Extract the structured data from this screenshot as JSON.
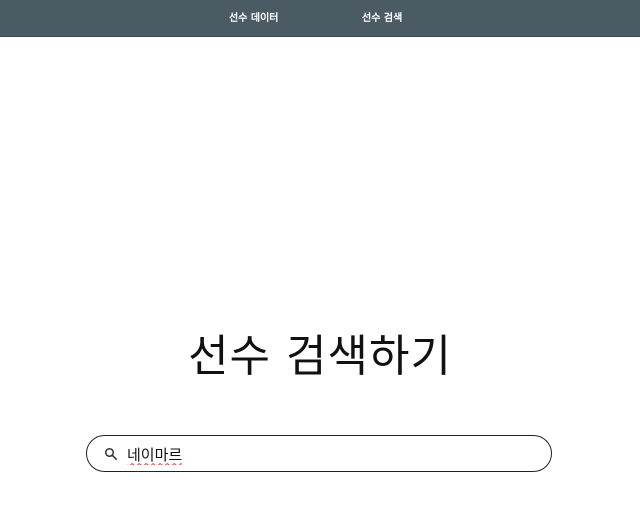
{
  "nav": {
    "items": [
      {
        "label": "선수 데이터"
      },
      {
        "label": "선수 검색"
      }
    ],
    "background": "#4b5b64"
  },
  "main": {
    "title": "선수 검색하기"
  },
  "search": {
    "value": "네이마르",
    "icon": "search-icon"
  }
}
